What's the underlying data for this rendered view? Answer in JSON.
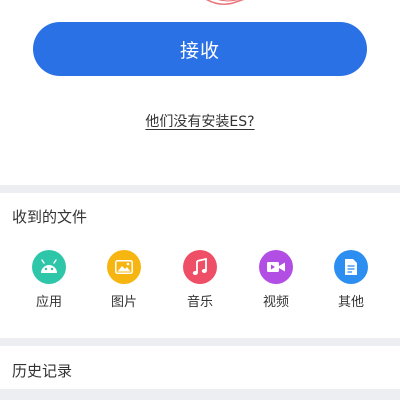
{
  "receive_button": {
    "label": "接收"
  },
  "no_es_link": {
    "label": "他们没有安装ES?"
  },
  "received_files": {
    "title": "收到的文件",
    "categories": [
      {
        "label": "应用",
        "icon": "android-icon",
        "color": "#2ec6a8"
      },
      {
        "label": "图片",
        "icon": "image-icon",
        "color": "#f7b511"
      },
      {
        "label": "音乐",
        "icon": "music-note-icon",
        "color": "#ee4f67"
      },
      {
        "label": "视频",
        "icon": "video-camera-icon",
        "color": "#b24ee3"
      },
      {
        "label": "其他",
        "icon": "document-icon",
        "color": "#2c8ef0"
      }
    ]
  },
  "history": {
    "title": "历史记录"
  },
  "colors": {
    "primary": "#2a71e6",
    "divider": "#eceef2",
    "text": "#333333"
  }
}
